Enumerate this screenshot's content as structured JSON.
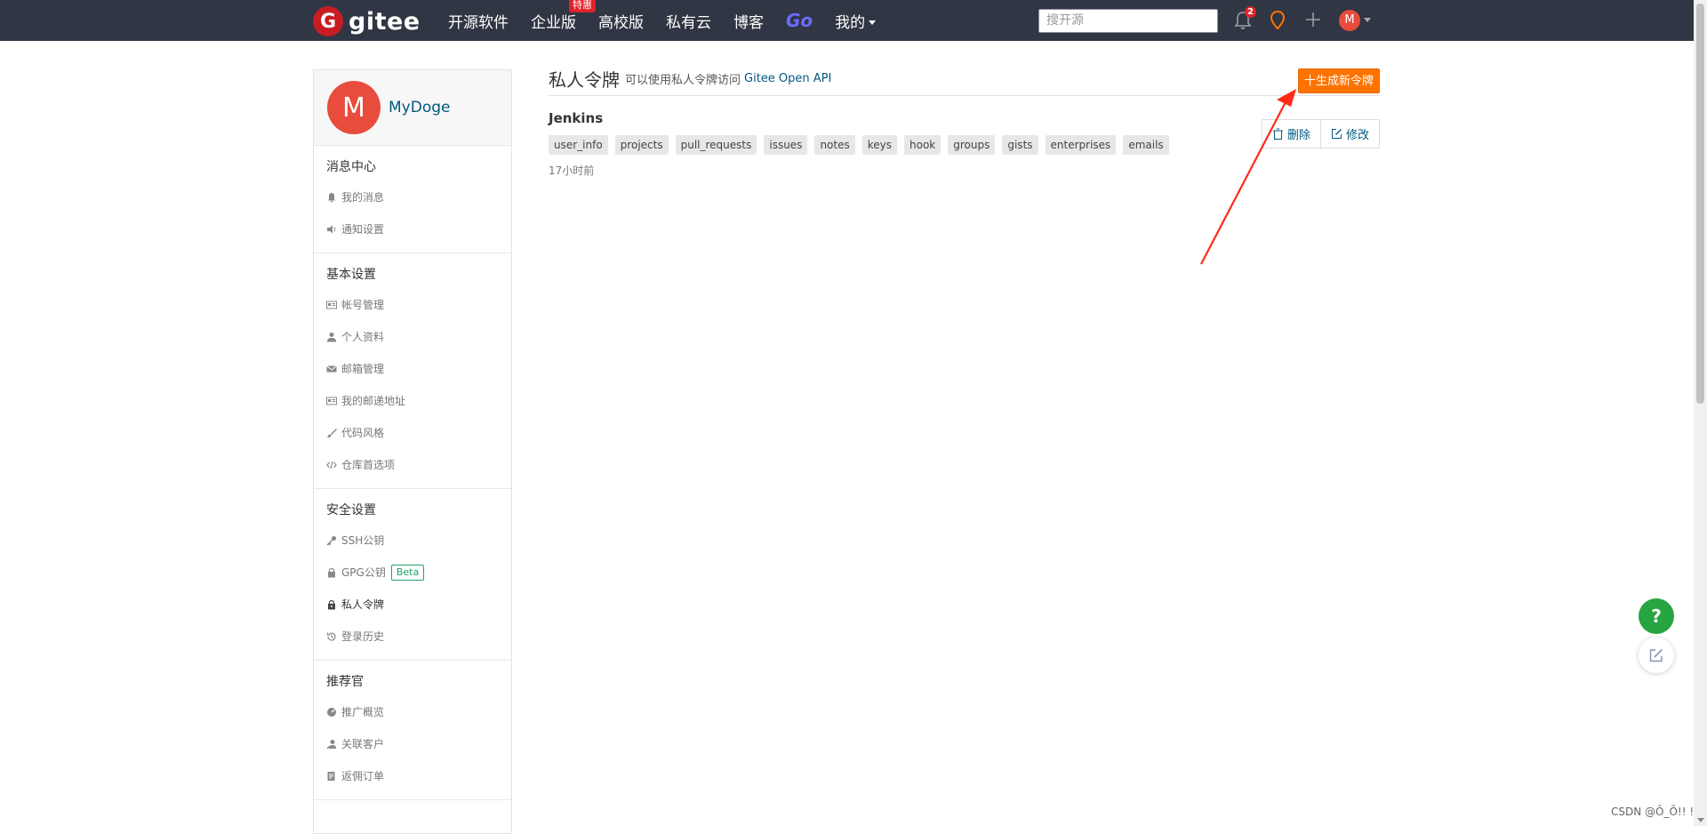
{
  "topnav": {
    "logo_text": "gitee",
    "items": [
      {
        "label": "开源软件"
      },
      {
        "label": "企业版",
        "badge": "特惠"
      },
      {
        "label": "高校版"
      },
      {
        "label": "私有云"
      },
      {
        "label": "博客"
      },
      {
        "label": "Go"
      },
      {
        "label": "我的"
      }
    ],
    "search_placeholder": "搜开源",
    "notification_count": "2",
    "avatar_initial": "M"
  },
  "sidebar": {
    "user": {
      "initial": "M",
      "name": "MyDoge"
    },
    "sections": [
      {
        "title": "消息中心",
        "items": [
          {
            "label": "我的消息",
            "icon": "bell-icon"
          },
          {
            "label": "通知设置",
            "icon": "speaker-icon"
          }
        ]
      },
      {
        "title": "基本设置",
        "items": [
          {
            "label": "帐号管理",
            "icon": "id-card-icon"
          },
          {
            "label": "个人资料",
            "icon": "user-icon"
          },
          {
            "label": "邮箱管理",
            "icon": "envelope-icon"
          },
          {
            "label": "我的邮递地址",
            "icon": "address-card-icon"
          },
          {
            "label": "代码风格",
            "icon": "brush-icon"
          },
          {
            "label": "仓库首选项",
            "icon": "code-icon"
          }
        ]
      },
      {
        "title": "安全设置",
        "items": [
          {
            "label": "SSH公钥",
            "icon": "key-icon"
          },
          {
            "label": "GPG公钥",
            "icon": "lock-icon",
            "badge": "Beta"
          },
          {
            "label": "私人令牌",
            "icon": "token-icon",
            "active": true
          },
          {
            "label": "登录历史",
            "icon": "history-icon"
          }
        ]
      },
      {
        "title": "推荐官",
        "items": [
          {
            "label": "推广概览",
            "icon": "dashboard-icon"
          },
          {
            "label": "关联客户",
            "icon": "user-link-icon"
          },
          {
            "label": "返佣订单",
            "icon": "order-icon"
          }
        ]
      }
    ]
  },
  "main": {
    "title": "私人令牌",
    "description": "可以使用私人令牌访问",
    "api_link": "Gitee Open API",
    "generate_button": "十生成新令牌",
    "tokens": [
      {
        "name": "Jenkins",
        "scopes": [
          "user_info",
          "projects",
          "pull_requests",
          "issues",
          "notes",
          "keys",
          "hook",
          "groups",
          "gists",
          "enterprises",
          "emails"
        ],
        "time": "17小时前",
        "delete_label": "删除",
        "edit_label": "修改"
      }
    ]
  },
  "floating": {
    "help_label": "?"
  },
  "watermark": "CSDN @Ō_Ō!! !",
  "colors": {
    "nav_bg": "#303643",
    "accent_orange": "#fe7300",
    "link": "#005980",
    "annotation_red": "#ff2a1a",
    "help_green": "#26a541"
  }
}
